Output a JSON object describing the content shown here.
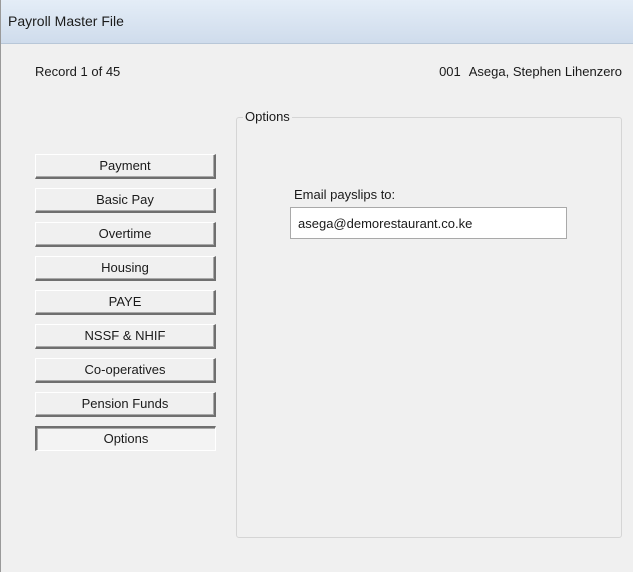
{
  "window": {
    "title": "Payroll Master File"
  },
  "record_bar": {
    "record_count": "Record 1 of 45",
    "employee_code": "001",
    "employee_name": "Asega, Stephen Lihenzero"
  },
  "nav": {
    "items": [
      {
        "label": "Payment",
        "active": false
      },
      {
        "label": "Basic Pay",
        "active": false
      },
      {
        "label": "Overtime",
        "active": false
      },
      {
        "label": "Housing",
        "active": false
      },
      {
        "label": "PAYE",
        "active": false
      },
      {
        "label": "NSSF & NHIF",
        "active": false
      },
      {
        "label": "Co-operatives",
        "active": false
      },
      {
        "label": "Pension Funds",
        "active": false
      },
      {
        "label": "Options",
        "active": true
      }
    ]
  },
  "options_panel": {
    "group_title": "Options",
    "email_label": "Email payslips to:",
    "email_value": "asega@demorestaurant.co.ke"
  }
}
